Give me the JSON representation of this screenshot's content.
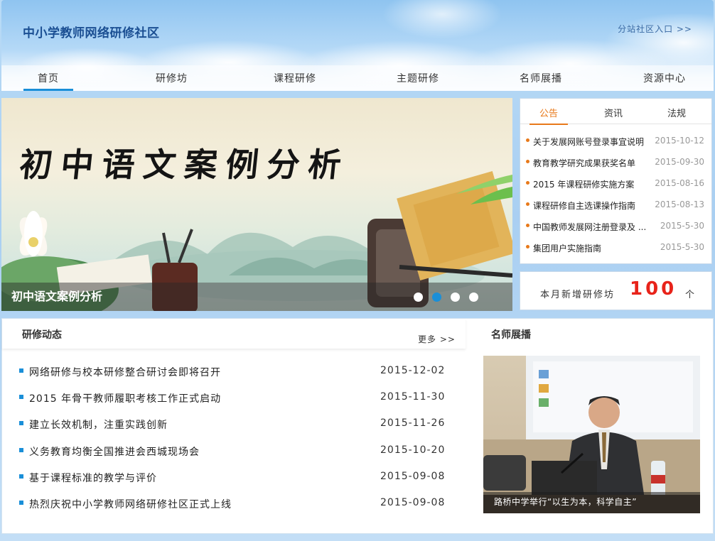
{
  "header": {
    "site_title": "中小学教师网络研修社区",
    "substation_link": "分站社区入口 >>"
  },
  "nav": {
    "items": [
      {
        "label": "首页",
        "active": true
      },
      {
        "label": "研修坊"
      },
      {
        "label": "课程研修"
      },
      {
        "label": "主题研修"
      },
      {
        "label": "名师展播"
      },
      {
        "label": "资源中心"
      }
    ]
  },
  "banner": {
    "calligraphy": "初中语文案例分析",
    "caption": "初中语文案例分析",
    "slide_count": 4,
    "active_slide": 2
  },
  "notice": {
    "tabs": [
      {
        "label": "公告",
        "active": true
      },
      {
        "label": "资讯"
      },
      {
        "label": "法规"
      }
    ],
    "items": [
      {
        "title": "关于发展网账号登录事宜说明",
        "date": "2015-10-12"
      },
      {
        "title": "教育教学研究成果获奖名单",
        "date": "2015-09-30"
      },
      {
        "title": "2015 年课程研修实施方案",
        "date": "2015-08-16"
      },
      {
        "title": "课程研修自主选课操作指南",
        "date": "2015-08-13"
      },
      {
        "title": "中国教师发展网注册登录及 ...",
        "date": "2015-5-30"
      },
      {
        "title": "集团用户实施指南",
        "date": "2015-5-30"
      }
    ]
  },
  "stats": {
    "label": "本月新增研修坊",
    "value": "100",
    "unit": "个"
  },
  "news": {
    "title": "研修动态",
    "more": "更多 >>",
    "items": [
      {
        "title": "网络研修与校本研修整合研讨会即将召开",
        "date": "2015-12-02"
      },
      {
        "title": "2015 年骨干教师履职考核工作正式启动",
        "date": "2015-11-30"
      },
      {
        "title": "建立长效机制，注重实践创新",
        "date": "2015-11-26"
      },
      {
        "title": "义务教育均衡全国推进会西城现场会",
        "date": "2015-10-20"
      },
      {
        "title": "基于课程标准的教学与评价",
        "date": "2015-09-08"
      },
      {
        "title": "热烈庆祝中小学教师网络研修社区正式上线",
        "date": "2015-09-08"
      }
    ]
  },
  "teacher": {
    "title": "名师展播",
    "caption": "路桥中学举行“以生为本，科学自主”"
  },
  "colors": {
    "accent_blue": "#1a8fd8",
    "accent_orange": "#e8791a",
    "stat_red": "#e8231a",
    "title_blue": "#1b4f93"
  }
}
